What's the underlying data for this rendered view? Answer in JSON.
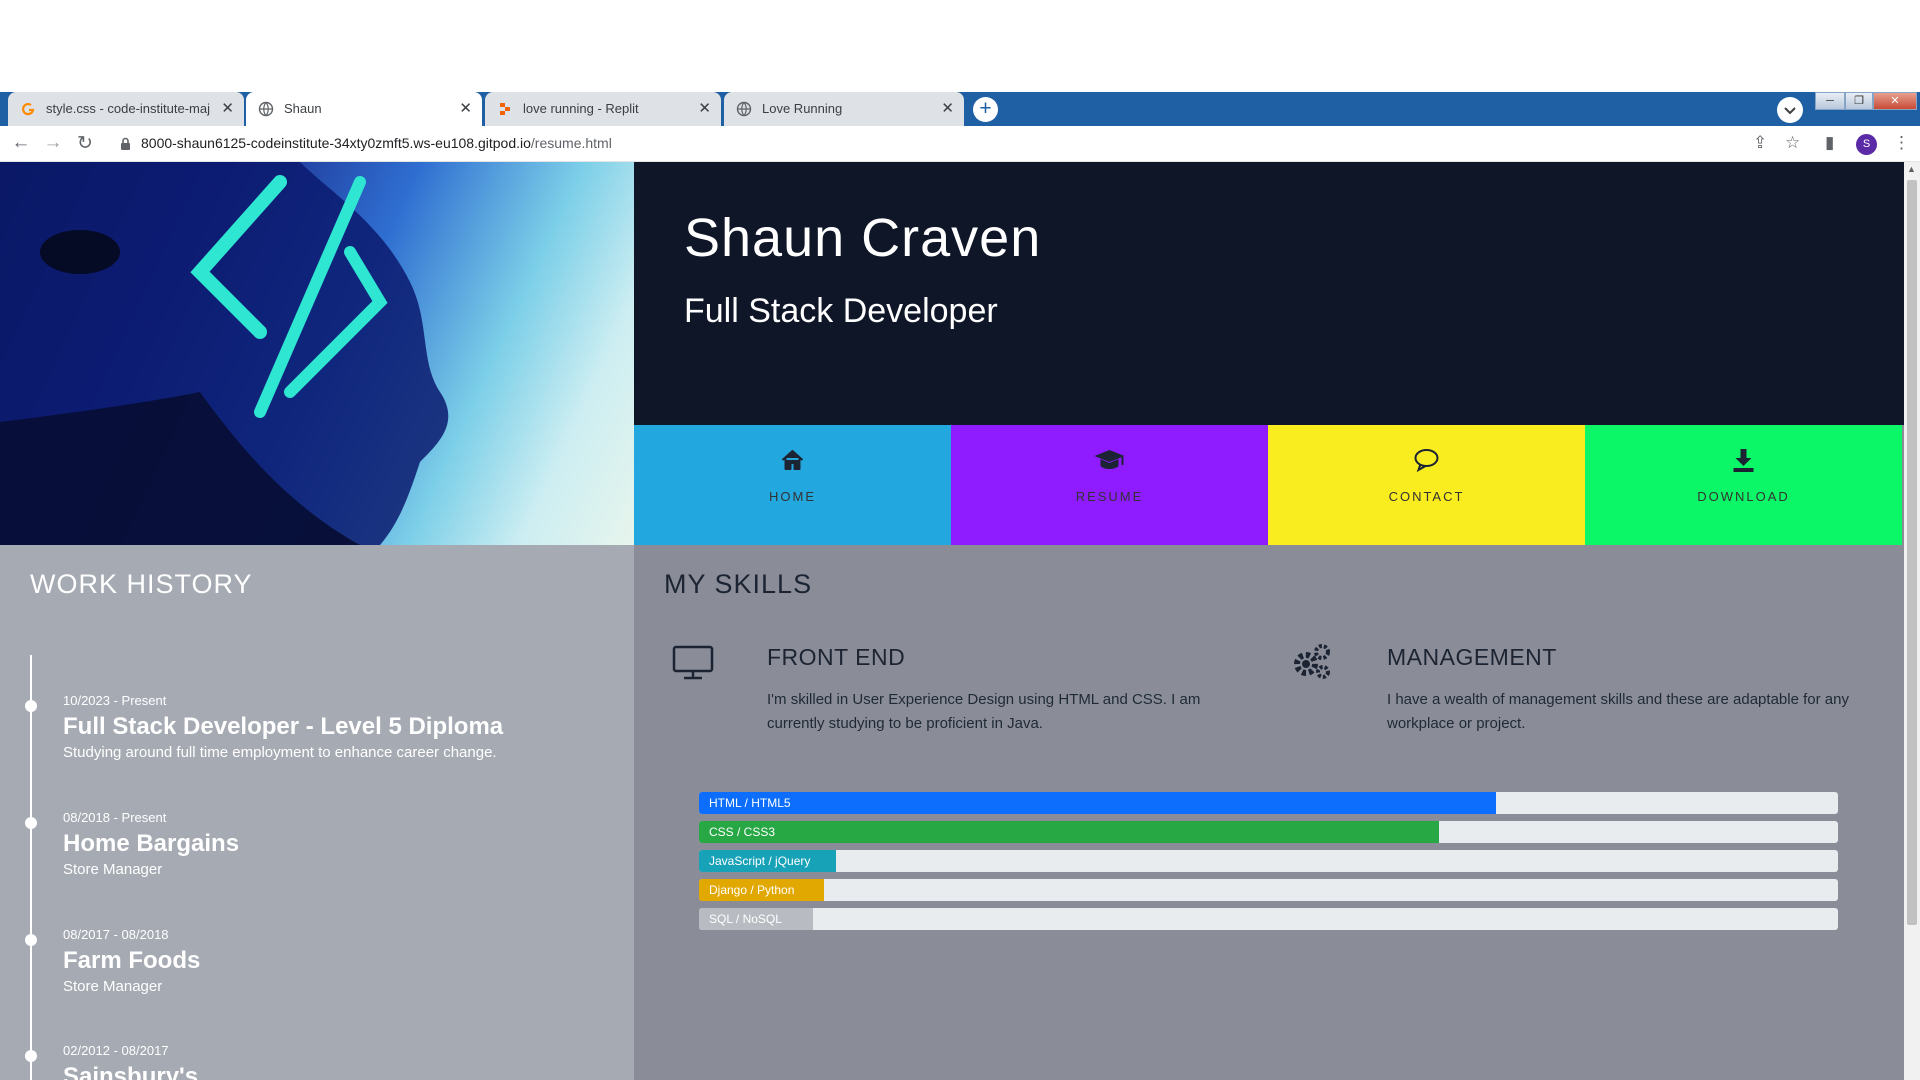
{
  "browser": {
    "tabs": [
      {
        "title": "style.css - code-institute-major-p",
        "icon": "gitpod-favicon",
        "active": false
      },
      {
        "title": "Shaun",
        "icon": "globe-favicon",
        "active": true
      },
      {
        "title": "love running - Replit",
        "icon": "replit-favicon",
        "active": false
      },
      {
        "title": "Love Running",
        "icon": "globe-favicon",
        "active": false
      }
    ],
    "tab_close_glyph": "✕",
    "new_tab_glyph": "+",
    "url_host": "8000-shaun6125-codeinstitute-34xty0zmft5.ws-eu108.gitpod.io",
    "url_path": "/resume.html",
    "profile_initial": "S",
    "colors": {
      "frame": "#1f5fa3",
      "tab_inactive": "#dee1e6",
      "tab_active": "#ffffff"
    }
  },
  "header": {
    "name": "Shaun Craven",
    "role": "Full Stack Developer"
  },
  "nav": [
    {
      "label": "HOME",
      "icon": "home-icon",
      "color": "#22a8df"
    },
    {
      "label": "RESUME",
      "icon": "graduation-cap-icon",
      "color": "#8e1cff"
    },
    {
      "label": "CONTACT",
      "icon": "speech-bubble-icon",
      "color": "#f9ec1f"
    },
    {
      "label": "DOWNLOAD",
      "icon": "download-icon",
      "color": "#0cf767"
    }
  ],
  "work": {
    "title": "WORK HISTORY",
    "jobs": [
      {
        "dates": "10/2023 - Present",
        "title": "Full Stack Developer - Level 5 Diploma",
        "desc": "Studying around full time employment to enhance career change."
      },
      {
        "dates": "08/2018 - Present",
        "title": "Home Bargains",
        "desc": "Store Manager"
      },
      {
        "dates": "08/2017 - 08/2018",
        "title": "Farm Foods",
        "desc": "Store Manager"
      },
      {
        "dates": "02/2012 - 08/2017",
        "title": "Sainsbury's",
        "desc": ""
      }
    ]
  },
  "skills": {
    "title": "MY SKILLS",
    "front_end": {
      "heading": "FRONT END",
      "text": "I'm skilled in User Experience Design using HTML and CSS. I am currently studying to be proficient in Java.",
      "icon": "monitor-icon"
    },
    "management": {
      "heading": "MANAGEMENT",
      "text": "I have a wealth of management skills and these are adaptable for any workplace or project.",
      "icon": "gears-icon"
    },
    "bars": [
      {
        "label": "HTML / HTML5",
        "percent": 70,
        "color": "#0d6efd"
      },
      {
        "label": "CSS / CSS3",
        "percent": 65,
        "color": "#28a745"
      },
      {
        "label": "JavaScript / jQuery",
        "percent": 12,
        "color": "#17a2b8"
      },
      {
        "label": "Django / Python",
        "percent": 11,
        "color": "#e0a800"
      },
      {
        "label": "SQL / NoSQL",
        "percent": 10,
        "color": "#b8bcc2"
      }
    ]
  }
}
